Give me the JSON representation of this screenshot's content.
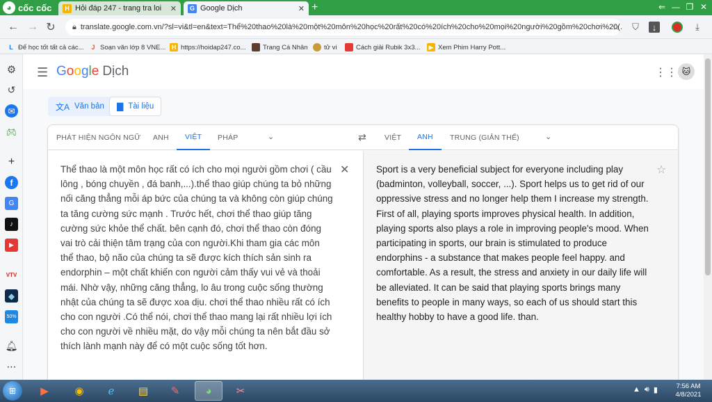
{
  "browser": {
    "brand": "cốc cốc",
    "tabs": [
      {
        "title": "Hỏi đáp 247 - trang tra loi",
        "active": false
      },
      {
        "title": "Google Dịch",
        "active": true
      }
    ],
    "url": "translate.google.com.vn/?sl=vi&tl=en&text=Thể%20thao%20là%20một%20môn%20học%20rất%20có%20ích%20cho%20mọi%20người%20gồm%20chơi%20(...",
    "bookmarks": [
      "Để học tốt tất cả các...",
      "Soạn văn lớp 8 VNE...",
      "https://hoidap247.co...",
      "Trang Cá Nhân",
      "tử vi",
      "Cách giải Rubik 3x3...",
      "Xem Phim Harry Pott..."
    ]
  },
  "header": {
    "logo_letters": [
      "G",
      "o",
      "o",
      "g",
      "l",
      "e"
    ],
    "product": "Dịch"
  },
  "modes": {
    "text": "Văn bản",
    "documents": "Tài liệu"
  },
  "source_langs": [
    "PHÁT HIỆN NGÔN NGỮ",
    "ANH",
    "VIỆT",
    "PHÁP"
  ],
  "target_langs": [
    "VIỆT",
    "ANH",
    "TRUNG (GIẢN THỂ)"
  ],
  "source_text": "Thể thao là một môn học rất có ích cho mọi người gồm chơi ( cầu lông , bóng chuyền , đá banh,...).thể thao giúp chúng ta bỏ những nối căng thẳng mỗi áp bức của chúng ta và không còn giúp chúng ta tăng cường sức mạnh . Trước hết, chơi thể thao giúp tăng cường sức khỏe thể chất. bên cạnh đó, chơi thể thao còn đóng vai trò cải thiện tâm trạng của con người.Khi tham gia các môn thể thao, bộ não của chúng ta sẽ được kích thích sản sinh ra endorphin – một chất khiến con người cảm thấy vui vẻ và thoải mái. Nhờ vậy, những căng thẳng, lo âu trong cuộc sống thường nhật của chúng ta sẽ được xoa dịu. chơi thể thao nhiều rất có ích cho con người .Có thể nói, chơi thể thao mang lại rất nhiều lợi ích cho con người về nhiều mặt, do vậy mỗi chúng ta nên bắt đầu sở thích lành mạnh này để có một cuộc sống tốt hơn.",
  "target_text": "Sport is a very beneficial subject for everyone including play (badminton, volleyball, soccer, ...). Sport helps us to get rid of our oppressive stress and no longer help them I increase my strength. First of all, playing sports improves physical health. In addition, playing sports also plays a role in improving people's mood. When participating in sports, our brain is stimulated to produce endorphins - a substance that makes people feel happy. and comfortable. As a result, the stress and anxiety in our daily life will be alleviated. It can be said that playing sports brings many benefits to people in many ways, so each of us should start this healthy hobby to have a good life. than.",
  "taskbar": {
    "time": "7:56 AM",
    "date": "4/8/2021"
  },
  "colors": {
    "accent": "#1a73e8",
    "browser_green": "#2f9e44"
  }
}
